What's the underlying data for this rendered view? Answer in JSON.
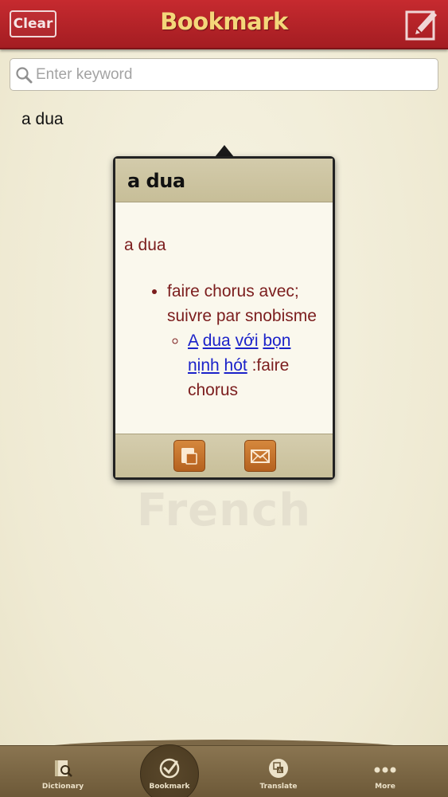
{
  "header": {
    "clear_label": "Clear",
    "title": "Bookmark",
    "edit_icon": "edit-icon"
  },
  "search": {
    "placeholder": "Enter keyword",
    "value": ""
  },
  "bookmarks": [
    {
      "word": "a dua"
    }
  ],
  "watermark": "French",
  "popup": {
    "title": "a dua",
    "entry_word": "a dua",
    "senses": [
      {
        "text": "faire chorus avec; suivre par snobisme",
        "examples": [
          {
            "links": [
              "A",
              "dua",
              "với",
              "bọn",
              "nịnh",
              "hót"
            ],
            "translation": ":faire chorus"
          }
        ]
      }
    ],
    "copy_icon": "copy-icon",
    "mail_icon": "mail-icon"
  },
  "tabs": [
    {
      "label": "Dictionary",
      "icon": "dictionary-icon",
      "active": false
    },
    {
      "label": "Bookmark",
      "icon": "bookmark-check-icon",
      "active": true
    },
    {
      "label": "Translate",
      "icon": "translate-icon",
      "active": false
    },
    {
      "label": "More",
      "icon": "more-dots-icon",
      "active": false
    }
  ],
  "colors": {
    "header_red": "#b5232a",
    "title_gold": "#f4d77a",
    "definition_text": "#7b1d1d",
    "link_blue": "#1b22c9",
    "tab_bar": "#7c6847"
  }
}
